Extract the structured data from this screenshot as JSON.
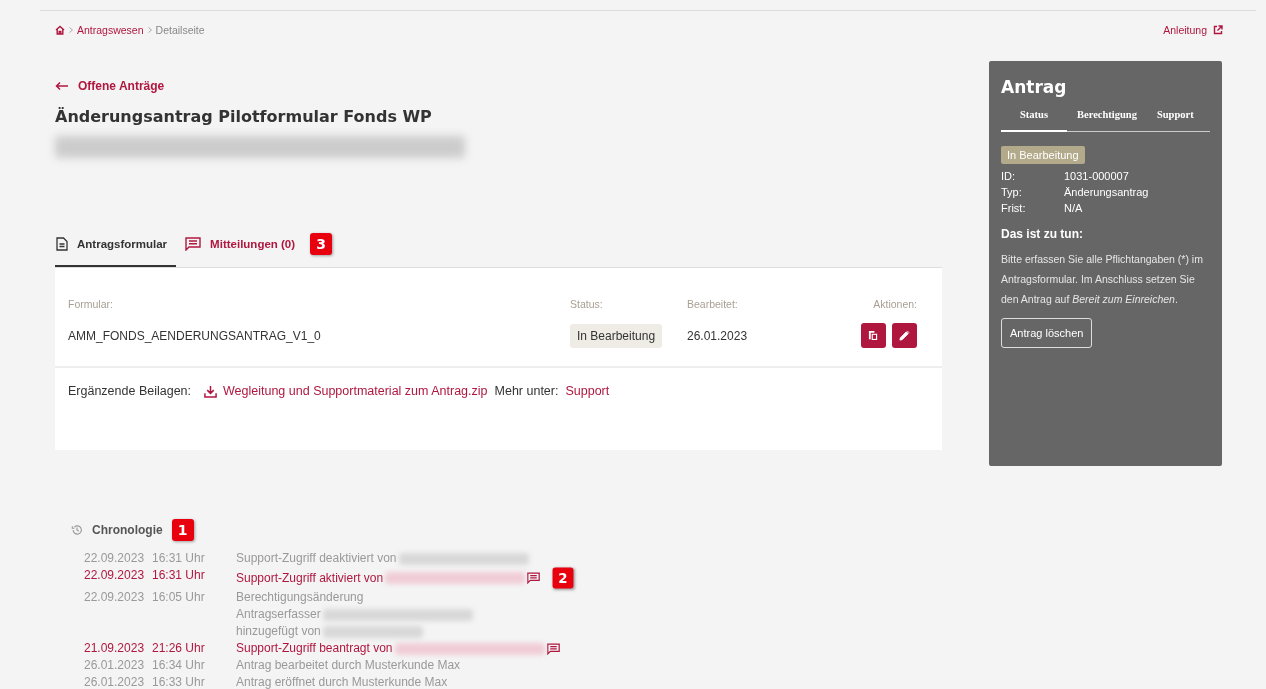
{
  "breadcrumb": {
    "items": [
      {
        "label": "Antragswesen",
        "link": true
      },
      {
        "label": "Detailseite",
        "link": false
      }
    ],
    "help_link": "Anleitung"
  },
  "back_link": "Offene Anträge",
  "title": "Änderungsantrag Pilotformular Fonds WP",
  "tabs": [
    {
      "label": "Antragsformular",
      "selected": true,
      "kind": "document"
    },
    {
      "label": "Mitteilungen (0)",
      "selected": false,
      "kind": "message",
      "badge": "3"
    }
  ],
  "form_table": {
    "columns": [
      "Formular:",
      "Status:",
      "Bearbeitet:",
      "Aktionen:"
    ],
    "row": {
      "formular": "AMM_FONDS_AENDERUNGSANTRAG_V1_0",
      "status": "In Bearbeitung",
      "edited": "26.01.2023"
    }
  },
  "attachments": {
    "label": "Ergänzende Beilagen:",
    "file_link": "Wegleitung und Supportmaterial zum Antrag.zip",
    "more_label": "Mehr unter:",
    "more_link": "Support"
  },
  "chronology": {
    "title": "Chronologie",
    "badge": "1",
    "entries": [
      {
        "date": "22.09.2023",
        "time": "16:31 Uhr",
        "highlight": false,
        "message_icon": false,
        "lines": [
          {
            "text": "Support-Zugriff deaktiviert von",
            "redacted": true
          }
        ]
      },
      {
        "date": "22.09.2023",
        "time": "16:31 Uhr",
        "highlight": true,
        "message_icon": true,
        "badge": "2",
        "lines": [
          {
            "text": "Support-Zugriff aktiviert von",
            "redacted": true
          }
        ]
      },
      {
        "date": "22.09.2023",
        "time": "16:05 Uhr",
        "highlight": false,
        "message_icon": false,
        "lines": [
          {
            "text": "Berechtigungsänderung",
            "redacted": false
          },
          {
            "text": "Antragserfasser",
            "redacted": true
          },
          {
            "text": "hinzugefügt von",
            "redacted": true
          }
        ]
      },
      {
        "date": "21.09.2023",
        "time": "21:26 Uhr",
        "highlight": true,
        "message_icon": true,
        "lines": [
          {
            "text": "Support-Zugriff beantragt von",
            "redacted": true
          }
        ]
      },
      {
        "date": "26.01.2023",
        "time": "16:34 Uhr",
        "highlight": false,
        "message_icon": false,
        "lines": [
          {
            "text": "Antrag bearbeitet durch Musterkunde Max",
            "redacted": false
          }
        ]
      },
      {
        "date": "26.01.2023",
        "time": "16:33 Uhr",
        "highlight": false,
        "message_icon": false,
        "lines": [
          {
            "text": "Antrag eröffnet durch Musterkunde Max",
            "redacted": false
          }
        ]
      }
    ]
  },
  "sidebar": {
    "title": "Antrag",
    "tabs": [
      {
        "label": "Status",
        "selected": true
      },
      {
        "label": "Berechtigung",
        "selected": false
      },
      {
        "label": "Support",
        "selected": false
      }
    ],
    "status": "In Bearbeitung",
    "fields": [
      {
        "label": "ID:",
        "value": "1031-000007"
      },
      {
        "label": "Typ:",
        "value": "Änderungsantrag"
      },
      {
        "label": "Frist:",
        "value": "N/A"
      }
    ],
    "todo_title": "Das ist zu tun:",
    "todo_text": "Bitte erfassen Sie alle Pflichtangaben (*) im Antragsformular. Im Anschluss setzen Sie den Antrag auf *Bereit zum Einreichen*.",
    "delete_button": "Antrag löschen"
  }
}
